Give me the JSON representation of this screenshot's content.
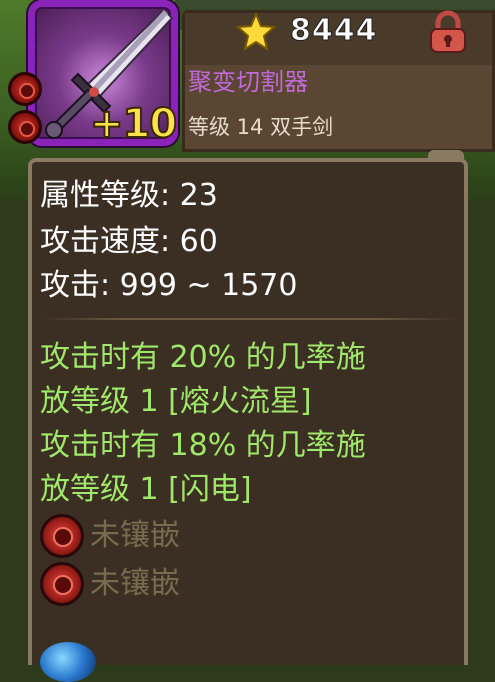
{
  "item": {
    "power": "8444",
    "enhance_level": "+10",
    "name": "聚变切割器",
    "subtitle": "等级 14 双手剑",
    "name_color": "#c06ad8"
  },
  "icons": {
    "power": "star-icon",
    "lock": "lock-icon",
    "weapon": "sword-icon",
    "socket": "red-gem-socket-icon"
  },
  "stats": [
    "属性等级: 23",
    "攻击速度: 60",
    "攻击: 999 ~ 1570"
  ],
  "effects": [
    "攻击时有 20% 的几率施",
    "放等级 1 [熔火流星]",
    "攻击时有 18% 的几率施",
    "放等级 1 [闪电]"
  ],
  "effect_color": "#9fe86a",
  "sockets": [
    {
      "label": "未镶嵌"
    },
    {
      "label": "未镶嵌"
    }
  ]
}
